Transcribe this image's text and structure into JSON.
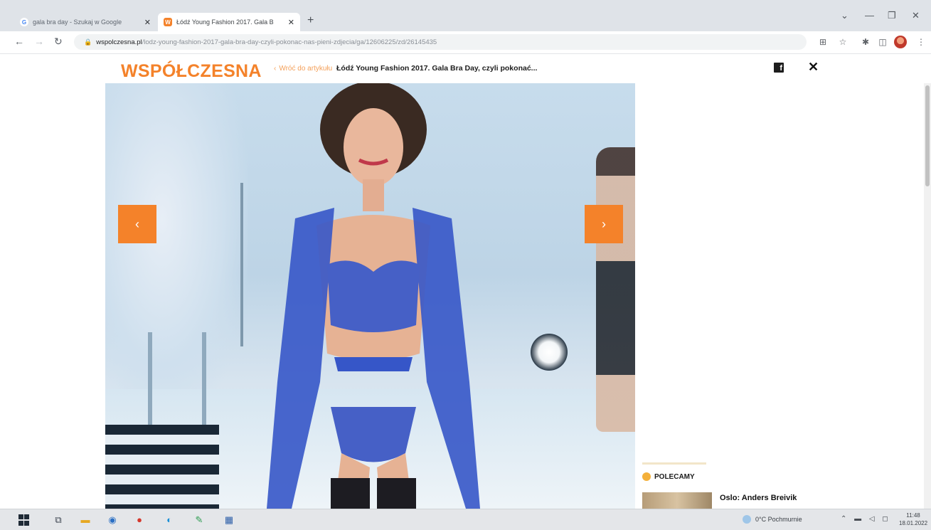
{
  "browser": {
    "tabs": [
      {
        "label": "gala bra day - Szukaj w Google",
        "favicon": "google-icon",
        "active": false
      },
      {
        "label": "Łódź Young Fashion 2017. Gala B",
        "favicon": "wspolczesna-icon",
        "active": true
      }
    ],
    "new_tab_label": "+",
    "address": {
      "domain": "wspolczesna.pl",
      "path": "/lodz-young-fashion-2017-gala-bra-day-czyli-pokonac-nas-pieni-zdjecia/ga/12606225/zd/26145435"
    },
    "toolbar_icons": [
      "back-icon",
      "forward-icon",
      "reload-icon",
      "translate-icon",
      "star-icon",
      "extensions-icon",
      "sidebar-icon",
      "profile-icon",
      "menu-icon"
    ]
  },
  "site": {
    "logo": "WSPÓŁCZESNA",
    "back_link": "Wróć do artykułu",
    "headline": "Łódź Young Fashion 2017. Gala Bra Day, czyli pokonać...",
    "facebook_label": "f",
    "close_label": "✕",
    "brand_color": "#f4822a"
  },
  "gallery": {
    "prev_label": "‹",
    "next_label": "›"
  },
  "sidebar": {
    "section_label": "POLECAMY",
    "recommendations": [
      {
        "title": "Oslo: Anders Breivik"
      }
    ]
  },
  "taskbar": {
    "weather": "0°C Pochmurnie",
    "time": "11:48",
    "date": "18.01.2022"
  }
}
